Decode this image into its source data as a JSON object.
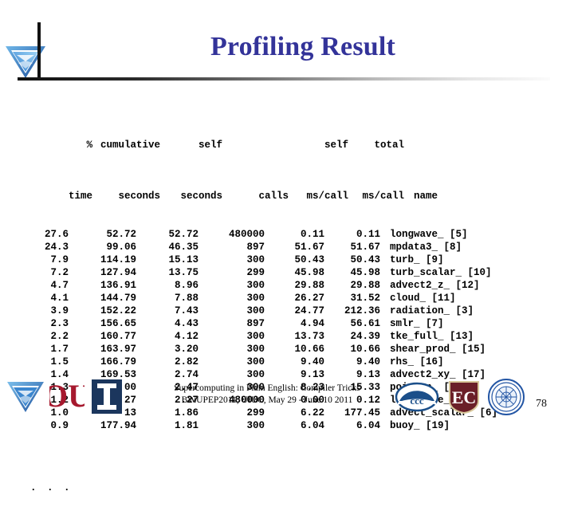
{
  "slide": {
    "title": "Profiling Result",
    "title_color": "#333399",
    "page_number": "78"
  },
  "profile": {
    "header_top": {
      "pct": "%",
      "cumulative": "cumulative",
      "self": "self",
      "calls": "",
      "self_mscall": "self",
      "total_mscall": "total",
      "name": ""
    },
    "header_bottom": {
      "pct": "time",
      "cumulative": "seconds",
      "self": "seconds",
      "calls": "calls",
      "self_mscall": "ms/call",
      "total_mscall": "ms/call",
      "name": "name"
    },
    "rows": [
      {
        "pct": "27.6",
        "cumulative": "52.72",
        "self": "52.72",
        "calls": "480000",
        "self_mscall": "0.11",
        "total_mscall": "0.11",
        "name": "longwave_ [5]"
      },
      {
        "pct": "24.3",
        "cumulative": "99.06",
        "self": "46.35",
        "calls": "897",
        "self_mscall": "51.67",
        "total_mscall": "51.67",
        "name": "mpdata3_ [8]"
      },
      {
        "pct": "7.9",
        "cumulative": "114.19",
        "self": "15.13",
        "calls": "300",
        "self_mscall": "50.43",
        "total_mscall": "50.43",
        "name": "turb_ [9]"
      },
      {
        "pct": "7.2",
        "cumulative": "127.94",
        "self": "13.75",
        "calls": "299",
        "self_mscall": "45.98",
        "total_mscall": "45.98",
        "name": "turb_scalar_ [10]"
      },
      {
        "pct": "4.7",
        "cumulative": "136.91",
        "self": "8.96",
        "calls": "300",
        "self_mscall": "29.88",
        "total_mscall": "29.88",
        "name": "advect2_z_ [12]"
      },
      {
        "pct": "4.1",
        "cumulative": "144.79",
        "self": "7.88",
        "calls": "300",
        "self_mscall": "26.27",
        "total_mscall": "31.52",
        "name": "cloud_ [11]"
      },
      {
        "pct": "3.9",
        "cumulative": "152.22",
        "self": "7.43",
        "calls": "300",
        "self_mscall": "24.77",
        "total_mscall": "212.36",
        "name": "radiation_ [3]"
      },
      {
        "pct": "2.3",
        "cumulative": "156.65",
        "self": "4.43",
        "calls": "897",
        "self_mscall": "4.94",
        "total_mscall": "56.61",
        "name": "smlr_ [7]"
      },
      {
        "pct": "2.2",
        "cumulative": "160.77",
        "self": "4.12",
        "calls": "300",
        "self_mscall": "13.73",
        "total_mscall": "24.39",
        "name": "tke_full_ [13]"
      },
      {
        "pct": "1.7",
        "cumulative": "163.97",
        "self": "3.20",
        "calls": "300",
        "self_mscall": "10.66",
        "total_mscall": "10.66",
        "name": "shear_prod_ [15]"
      },
      {
        "pct": "1.5",
        "cumulative": "166.79",
        "self": "2.82",
        "calls": "300",
        "self_mscall": "9.40",
        "total_mscall": "9.40",
        "name": "rhs_ [16]"
      },
      {
        "pct": "1.4",
        "cumulative": "169.53",
        "self": "2.74",
        "calls": "300",
        "self_mscall": "9.13",
        "total_mscall": "9.13",
        "name": "advect2_xy_ [17]"
      },
      {
        "pct": "1.3",
        "cumulative": "172.00",
        "self": "2.47",
        "calls": "300",
        "self_mscall": "8.23",
        "total_mscall": "15.33",
        "name": "poisson_ [14]"
      },
      {
        "pct": "1.2",
        "cumulative": "174.27",
        "self": "2.27",
        "calls": "480000",
        "self_mscall": "0.00",
        "total_mscall": "0.12",
        "name": "long_wave_ [4]"
      },
      {
        "pct": "1.0",
        "cumulative": "176.13",
        "self": "1.86",
        "calls": "299",
        "self_mscall": "6.22",
        "total_mscall": "177.45",
        "name": "advect_scalar_ [6]"
      },
      {
        "pct": "0.9",
        "cumulative": "177.94",
        "self": "1.81",
        "calls": "300",
        "self_mscall": "6.04",
        "total_mscall": "6.04",
        "name": "buoy_ [19]"
      }
    ],
    "ellipsis": ". . ."
  },
  "footer": {
    "line1": "Supercomputing in Plain English: Compiler Tricks",
    "line2": "BWUPEP2011, UIUC, May 29 - June 10 2011",
    "logos": [
      {
        "name": "blue-waters-logo",
        "color": "#2b6cb8"
      },
      {
        "name": "ou-logo",
        "color": "#a6192e"
      },
      {
        "name": "illinois-logo",
        "color": "#1b365d"
      },
      {
        "name": "ccc-logo",
        "color": "#1b4f8a"
      },
      {
        "name": "ec-logo",
        "color": "#6b1f28"
      },
      {
        "name": "university-seal-logo",
        "color": "#2255a4"
      }
    ]
  }
}
